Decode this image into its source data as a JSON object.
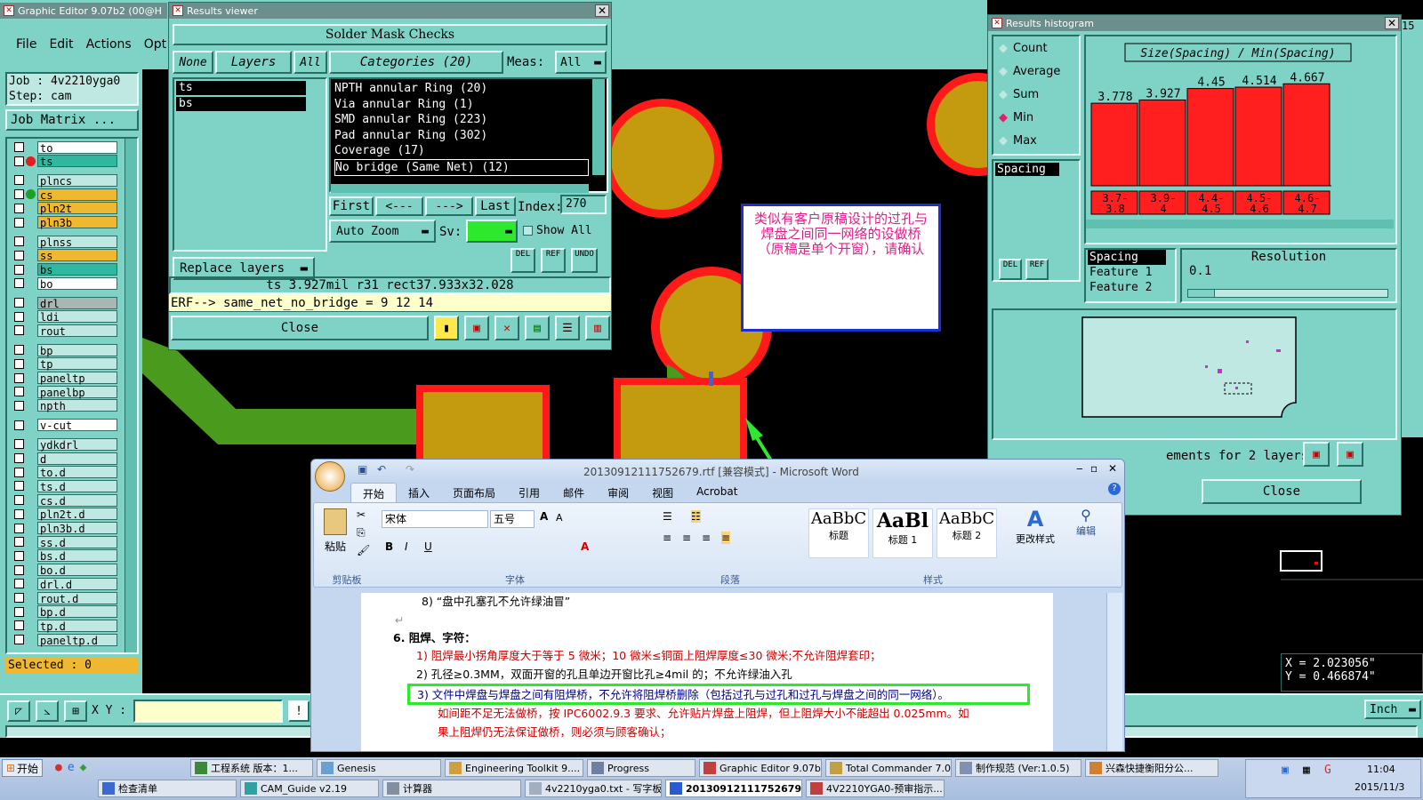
{
  "main_window": {
    "title": "Graphic Editor 9.07b2 (00@H",
    "menu": [
      "File",
      "Edit",
      "Actions",
      "Opt"
    ],
    "job_label": "Job : 4v2210yga0",
    "step_label": "Step: cam",
    "job_matrix": "Job Matrix ...",
    "layers": [
      {
        "name": "to",
        "color": "#ffffff",
        "dot": ""
      },
      {
        "name": "ts",
        "color": "#2fb79f",
        "dot": "#e02020"
      },
      {
        "name": "plncs",
        "color": "#bfe8e2",
        "dot": ""
      },
      {
        "name": "cs",
        "color": "#f0b830",
        "dot": "#20a020"
      },
      {
        "name": "pln2t",
        "color": "#f0b830",
        "dot": ""
      },
      {
        "name": "pln3b",
        "color": "#f0b830",
        "dot": ""
      },
      {
        "name": "plnss",
        "color": "#bfe8e2",
        "dot": ""
      },
      {
        "name": "ss",
        "color": "#f0b830",
        "dot": ""
      },
      {
        "name": "bs",
        "color": "#2fb79f",
        "dot": ""
      },
      {
        "name": "bo",
        "color": "#ffffff",
        "dot": ""
      },
      {
        "name": "drl",
        "color": "#a8b6b4",
        "dot": ""
      },
      {
        "name": "ldi",
        "color": "#bfe8e2",
        "dot": ""
      },
      {
        "name": "rout",
        "color": "#bfe8e2",
        "dot": ""
      },
      {
        "name": "bp",
        "color": "#bfe8e2",
        "dot": ""
      },
      {
        "name": "tp",
        "color": "#bfe8e2",
        "dot": ""
      },
      {
        "name": "paneltp",
        "color": "#bfe8e2",
        "dot": ""
      },
      {
        "name": "panelbp",
        "color": "#bfe8e2",
        "dot": ""
      },
      {
        "name": "npth",
        "color": "#bfe8e2",
        "dot": ""
      },
      {
        "name": "v-cut",
        "color": "#ffffff",
        "dot": ""
      },
      {
        "name": "ydkdrl",
        "color": "#bfe8e2",
        "dot": ""
      },
      {
        "name": "d",
        "color": "#bfe8e2",
        "dot": ""
      },
      {
        "name": "to.d",
        "color": "#bfe8e2",
        "dot": ""
      },
      {
        "name": "ts.d",
        "color": "#bfe8e2",
        "dot": ""
      },
      {
        "name": "cs.d",
        "color": "#bfe8e2",
        "dot": ""
      },
      {
        "name": "pln2t.d",
        "color": "#bfe8e2",
        "dot": ""
      },
      {
        "name": "pln3b.d",
        "color": "#bfe8e2",
        "dot": ""
      },
      {
        "name": "ss.d",
        "color": "#bfe8e2",
        "dot": ""
      },
      {
        "name": "bs.d",
        "color": "#bfe8e2",
        "dot": ""
      },
      {
        "name": "bo.d",
        "color": "#bfe8e2",
        "dot": ""
      },
      {
        "name": "drl.d",
        "color": "#bfe8e2",
        "dot": ""
      },
      {
        "name": "rout.d",
        "color": "#bfe8e2",
        "dot": ""
      },
      {
        "name": "bp.d",
        "color": "#bfe8e2",
        "dot": ""
      },
      {
        "name": "tp.d",
        "color": "#bfe8e2",
        "dot": ""
      },
      {
        "name": "paneltp.d",
        "color": "#bfe8e2",
        "dot": ""
      }
    ],
    "selected": "Selected : 0",
    "xy_label": "X Y :",
    "coord_x": "X = 2.023056\"",
    "coord_y": "Y = 0.466874\"",
    "units": "Inch",
    "partial_right": "15"
  },
  "results_viewer": {
    "title": "Results viewer",
    "header": "Solder Mask Checks",
    "tabs": [
      "None",
      "Layers",
      "All"
    ],
    "layers": [
      "ts",
      "bs"
    ],
    "categories_label": "Categories (20)",
    "meas_label": "Meas:",
    "meas_value": "All",
    "categories": [
      "NPTH annular Ring (20)",
      "Via annular Ring (1)",
      "SMD annular Ring (223)",
      "Pad annular Ring (302)",
      "Coverage (17)",
      "No bridge (Same Net) (12)"
    ],
    "nav": [
      "First",
      "<---",
      "--->",
      "Last"
    ],
    "index_label": "Index:",
    "index_value": "270",
    "auto_zoom": "Auto Zoom",
    "sv_label": "Sv:",
    "show_all": "Show All",
    "replace_layers": "Replace layers",
    "mini": [
      "DEL",
      "REF",
      "UNDO"
    ],
    "status": "ts 3.927mil   r31   rect37.933x32.028",
    "erf": "ERF--> same_net_no_bridge = 9 12 14",
    "close": "Close"
  },
  "annotation": {
    "text": "类似有客户原稿设计的过孔与焊盘之间同一网络的设做桥（原稿是单个开窗），请确认"
  },
  "histogram": {
    "title": "Results histogram",
    "options": [
      "Count",
      "Average",
      "Sum",
      "Min",
      "Max"
    ],
    "selected_option": "Min",
    "list_item": "Spacing",
    "mini": [
      "DEL",
      "REF"
    ],
    "feature_list": [
      "Spacing",
      "Feature 1",
      "Feature 2"
    ],
    "resolution_label": "Resolution",
    "resolution_value": "0.1",
    "footer": "ements for 2 layers",
    "close": "Close"
  },
  "chart_data": {
    "type": "bar",
    "title": "Size(Spacing) / Min(Spacing)",
    "categories": [
      "3.7- 3.8",
      "3.9- 4",
      "4.4- 4.5",
      "4.5- 4.6",
      "4.6- 4.7"
    ],
    "value_labels": [
      "3.778",
      "3.927",
      "4.45",
      "4.514",
      "4.667"
    ],
    "values": [
      3.778,
      3.927,
      4.45,
      4.514,
      4.667
    ],
    "bar_color": "#ff1f1f"
  },
  "word": {
    "title": "20130912111752679.rtf [兼容模式] - Microsoft Word",
    "tabs": [
      "开始",
      "插入",
      "页面布局",
      "引用",
      "邮件",
      "审阅",
      "视图",
      "Acrobat"
    ],
    "font_name": "宋体",
    "font_size": "五号",
    "groups": [
      "剪贴板",
      "字体",
      "段落",
      "样式"
    ],
    "paste": "粘贴",
    "styles": [
      {
        "preview": "AaBbC",
        "label": "标题"
      },
      {
        "preview": "AaBl",
        "label": "标题 1"
      },
      {
        "preview": "AaBbC",
        "label": "标题 2"
      }
    ],
    "change_styles": "更改样式",
    "edit": "编辑",
    "doc": {
      "line8": "8) “盘中孔塞孔不允许绿油冒”",
      "section": "6.  阻焊、字符：",
      "item1": "1) 阻焊最小拐角厚度大于等于 5 微米；10 微米≤铜面上阻焊厚度≤30 微米;不允许阻焊套印；",
      "item2": "2) 孔径≥0.3MM，双面开窗的孔且单边开窗比孔≥4mil 的；不允许绿油入孔",
      "item3": "3) 文件中焊盘与焊盘之间有阻焊桥，不允许将阻焊桥删除（包括过孔与过孔和过孔与焊盘之间的同一网络）。",
      "item3b": "如间距不足无法做桥，按 IPC6002.9.3 要求、允许贴片焊盘上阻焊，但上阻焊大小不能超出 0.025mm。如",
      "item3c": "果上阻焊仍无法保证做桥，则必须与顾客确认；"
    }
  },
  "taskbar": {
    "start": "开始",
    "row1": [
      "工程系统  版本：1...",
      "Genesis",
      "Engineering Toolkit 9....",
      "Progress",
      "Graphic Editor 9.07b2...",
      "Total Commander 7.0...",
      "制作规范 (Ver:1.0.5)",
      "兴森快捷衡阳分公..."
    ],
    "row2": [
      "检查清单",
      "CAM_Guide v2.19",
      "计算器",
      "4v2210yga0.txt - 写字板",
      "20130912111752679....",
      "4V2210YGA0-预审指示...."
    ],
    "time": "11:04",
    "date": "2015/11/3"
  }
}
